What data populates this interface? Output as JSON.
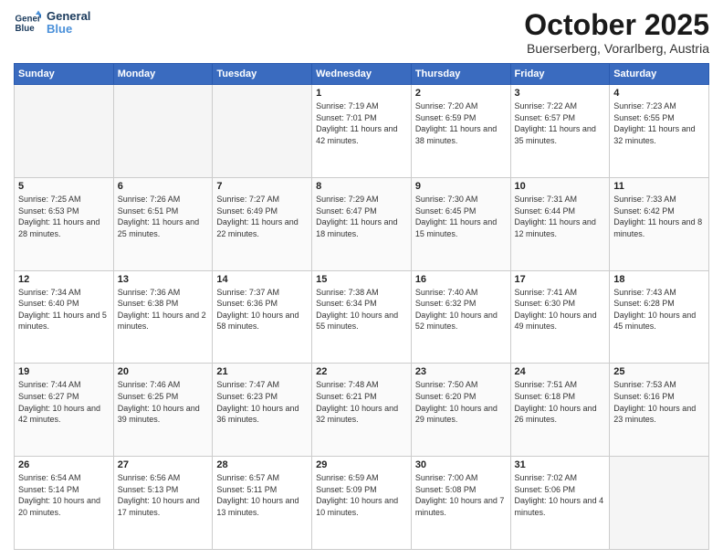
{
  "header": {
    "logo_line1": "General",
    "logo_line2": "Blue",
    "month_title": "October 2025",
    "subtitle": "Buerserberg, Vorarlberg, Austria"
  },
  "weekdays": [
    "Sunday",
    "Monday",
    "Tuesday",
    "Wednesday",
    "Thursday",
    "Friday",
    "Saturday"
  ],
  "weeks": [
    [
      {
        "day": "",
        "empty": true
      },
      {
        "day": "",
        "empty": true
      },
      {
        "day": "",
        "empty": true
      },
      {
        "day": "1",
        "sunrise": "7:19 AM",
        "sunset": "7:01 PM",
        "daylight": "11 hours and 42 minutes."
      },
      {
        "day": "2",
        "sunrise": "7:20 AM",
        "sunset": "6:59 PM",
        "daylight": "11 hours and 38 minutes."
      },
      {
        "day": "3",
        "sunrise": "7:22 AM",
        "sunset": "6:57 PM",
        "daylight": "11 hours and 35 minutes."
      },
      {
        "day": "4",
        "sunrise": "7:23 AM",
        "sunset": "6:55 PM",
        "daylight": "11 hours and 32 minutes."
      }
    ],
    [
      {
        "day": "5",
        "sunrise": "7:25 AM",
        "sunset": "6:53 PM",
        "daylight": "11 hours and 28 minutes."
      },
      {
        "day": "6",
        "sunrise": "7:26 AM",
        "sunset": "6:51 PM",
        "daylight": "11 hours and 25 minutes."
      },
      {
        "day": "7",
        "sunrise": "7:27 AM",
        "sunset": "6:49 PM",
        "daylight": "11 hours and 22 minutes."
      },
      {
        "day": "8",
        "sunrise": "7:29 AM",
        "sunset": "6:47 PM",
        "daylight": "11 hours and 18 minutes."
      },
      {
        "day": "9",
        "sunrise": "7:30 AM",
        "sunset": "6:45 PM",
        "daylight": "11 hours and 15 minutes."
      },
      {
        "day": "10",
        "sunrise": "7:31 AM",
        "sunset": "6:44 PM",
        "daylight": "11 hours and 12 minutes."
      },
      {
        "day": "11",
        "sunrise": "7:33 AM",
        "sunset": "6:42 PM",
        "daylight": "11 hours and 8 minutes."
      }
    ],
    [
      {
        "day": "12",
        "sunrise": "7:34 AM",
        "sunset": "6:40 PM",
        "daylight": "11 hours and 5 minutes."
      },
      {
        "day": "13",
        "sunrise": "7:36 AM",
        "sunset": "6:38 PM",
        "daylight": "11 hours and 2 minutes."
      },
      {
        "day": "14",
        "sunrise": "7:37 AM",
        "sunset": "6:36 PM",
        "daylight": "10 hours and 58 minutes."
      },
      {
        "day": "15",
        "sunrise": "7:38 AM",
        "sunset": "6:34 PM",
        "daylight": "10 hours and 55 minutes."
      },
      {
        "day": "16",
        "sunrise": "7:40 AM",
        "sunset": "6:32 PM",
        "daylight": "10 hours and 52 minutes."
      },
      {
        "day": "17",
        "sunrise": "7:41 AM",
        "sunset": "6:30 PM",
        "daylight": "10 hours and 49 minutes."
      },
      {
        "day": "18",
        "sunrise": "7:43 AM",
        "sunset": "6:28 PM",
        "daylight": "10 hours and 45 minutes."
      }
    ],
    [
      {
        "day": "19",
        "sunrise": "7:44 AM",
        "sunset": "6:27 PM",
        "daylight": "10 hours and 42 minutes."
      },
      {
        "day": "20",
        "sunrise": "7:46 AM",
        "sunset": "6:25 PM",
        "daylight": "10 hours and 39 minutes."
      },
      {
        "day": "21",
        "sunrise": "7:47 AM",
        "sunset": "6:23 PM",
        "daylight": "10 hours and 36 minutes."
      },
      {
        "day": "22",
        "sunrise": "7:48 AM",
        "sunset": "6:21 PM",
        "daylight": "10 hours and 32 minutes."
      },
      {
        "day": "23",
        "sunrise": "7:50 AM",
        "sunset": "6:20 PM",
        "daylight": "10 hours and 29 minutes."
      },
      {
        "day": "24",
        "sunrise": "7:51 AM",
        "sunset": "6:18 PM",
        "daylight": "10 hours and 26 minutes."
      },
      {
        "day": "25",
        "sunrise": "7:53 AM",
        "sunset": "6:16 PM",
        "daylight": "10 hours and 23 minutes."
      }
    ],
    [
      {
        "day": "26",
        "sunrise": "6:54 AM",
        "sunset": "5:14 PM",
        "daylight": "10 hours and 20 minutes."
      },
      {
        "day": "27",
        "sunrise": "6:56 AM",
        "sunset": "5:13 PM",
        "daylight": "10 hours and 17 minutes."
      },
      {
        "day": "28",
        "sunrise": "6:57 AM",
        "sunset": "5:11 PM",
        "daylight": "10 hours and 13 minutes."
      },
      {
        "day": "29",
        "sunrise": "6:59 AM",
        "sunset": "5:09 PM",
        "daylight": "10 hours and 10 minutes."
      },
      {
        "day": "30",
        "sunrise": "7:00 AM",
        "sunset": "5:08 PM",
        "daylight": "10 hours and 7 minutes."
      },
      {
        "day": "31",
        "sunrise": "7:02 AM",
        "sunset": "5:06 PM",
        "daylight": "10 hours and 4 minutes."
      },
      {
        "day": "",
        "empty": true
      }
    ]
  ],
  "labels": {
    "sunrise_prefix": "Sunrise: ",
    "sunset_prefix": "Sunset: ",
    "daylight_prefix": "Daylight: "
  }
}
